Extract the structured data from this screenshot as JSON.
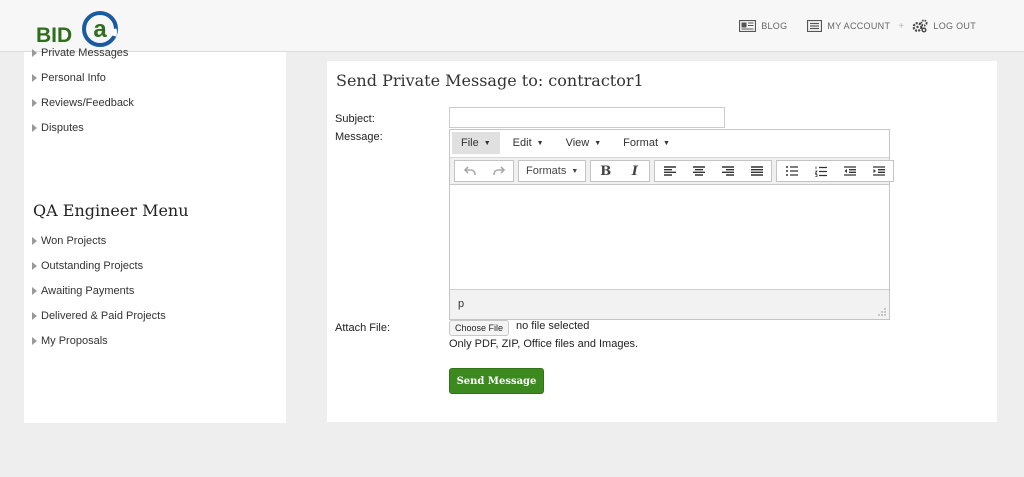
{
  "header": {
    "logo_text": "BID",
    "logo_mark": "a",
    "nav": {
      "blog": "BLOG",
      "account": "MY ACCOUNT",
      "separator": "+",
      "logout": "LOG OUT"
    }
  },
  "sidebar": {
    "top_links": [
      {
        "label": "Private Messages"
      },
      {
        "label": "Personal Info"
      },
      {
        "label": "Reviews/Feedback"
      },
      {
        "label": "Disputes"
      }
    ],
    "menu_heading": "QA Engineer Menu",
    "menu_links": [
      {
        "label": "Won Projects"
      },
      {
        "label": "Outstanding Projects"
      },
      {
        "label": "Awaiting Payments"
      },
      {
        "label": "Delivered & Paid Projects"
      },
      {
        "label": "My Proposals"
      }
    ]
  },
  "form": {
    "title": "Send Private Message to: contractor1",
    "subject_label": "Subject:",
    "subject_value": "",
    "message_label": "Message:",
    "editor": {
      "menus": [
        "File",
        "Edit",
        "View",
        "Format"
      ],
      "active_menu": "File",
      "formats_label": "Formats",
      "bold_label": "B",
      "italic_label": "I",
      "status_path": "p"
    },
    "attach_label": "Attach File:",
    "choose_file_label": "Choose File",
    "file_status": "no file selected",
    "file_hint": "Only PDF, ZIP, Office files and Images.",
    "send_label": "Send Message"
  },
  "colors": {
    "brand_green": "#3c8a1f",
    "logo_green": "#2e6e1e"
  }
}
